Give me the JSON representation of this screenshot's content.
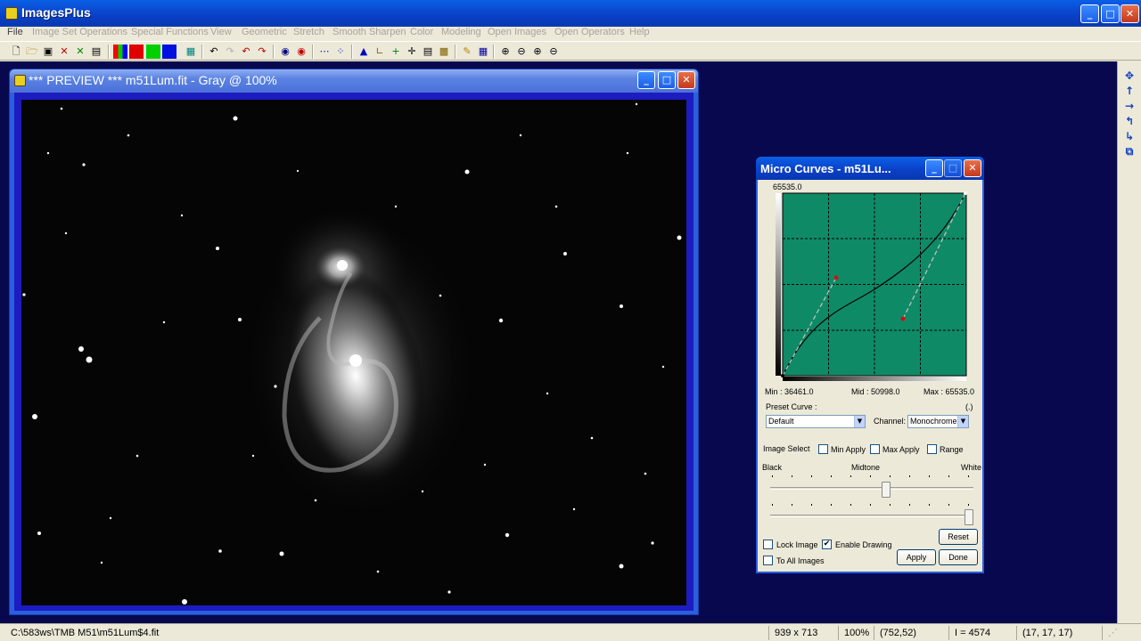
{
  "app": {
    "title": "ImagesPlus"
  },
  "menu": [
    "File",
    "Image Set Operations",
    "Special Functions",
    "View",
    "Geometric",
    "Stretch",
    "Smooth Sharpen",
    "Color",
    "Modeling",
    "Open Images",
    "Open Operators",
    "Help"
  ],
  "window_buttons": {
    "minimize": "_",
    "maximize": "□",
    "close": "✕"
  },
  "preview": {
    "title": "*** PREVIEW *** m51Lum.fit - Gray @ 100%"
  },
  "micro_curves": {
    "title": "Micro Curves - m51Lu...",
    "top_value": "65535.0",
    "min_label": "Min :  36461.0",
    "mid_label": "Mid :  50998.0",
    "max_label": "Max :  65535.0",
    "preset_label": "Preset Curve :",
    "bracket": "(.)",
    "preset_value": "Default",
    "channel_label": "Channel:",
    "channel_value": "Monochrome",
    "image_select": "Image Select",
    "min_apply": "Min Apply",
    "max_apply": "Max Apply",
    "range": "Range",
    "black": "Black",
    "midtone": "Midtone",
    "white": "White",
    "midtone_slider_level": 0.57,
    "white_slider_level": 0.98,
    "lock_image": "Lock Image",
    "enable_drawing": "Enable Drawing",
    "enable_drawing_checked": "✔",
    "to_all_images": "To All Images",
    "reset": "Reset",
    "apply": "Apply",
    "done": "Done"
  },
  "status": {
    "path": "C:\\583ws\\TMB M51\\m51Lum$4.fit",
    "dims": "939 x 713",
    "zoom": "100%",
    "coords": "(752,52)",
    "intensity": "I = 4574",
    "rgb": "(17, 17, 17)"
  },
  "colors": {
    "workspace": "#08084e",
    "curve_bg": "#0f8a66",
    "xp_blue": "#0a5fe6"
  }
}
